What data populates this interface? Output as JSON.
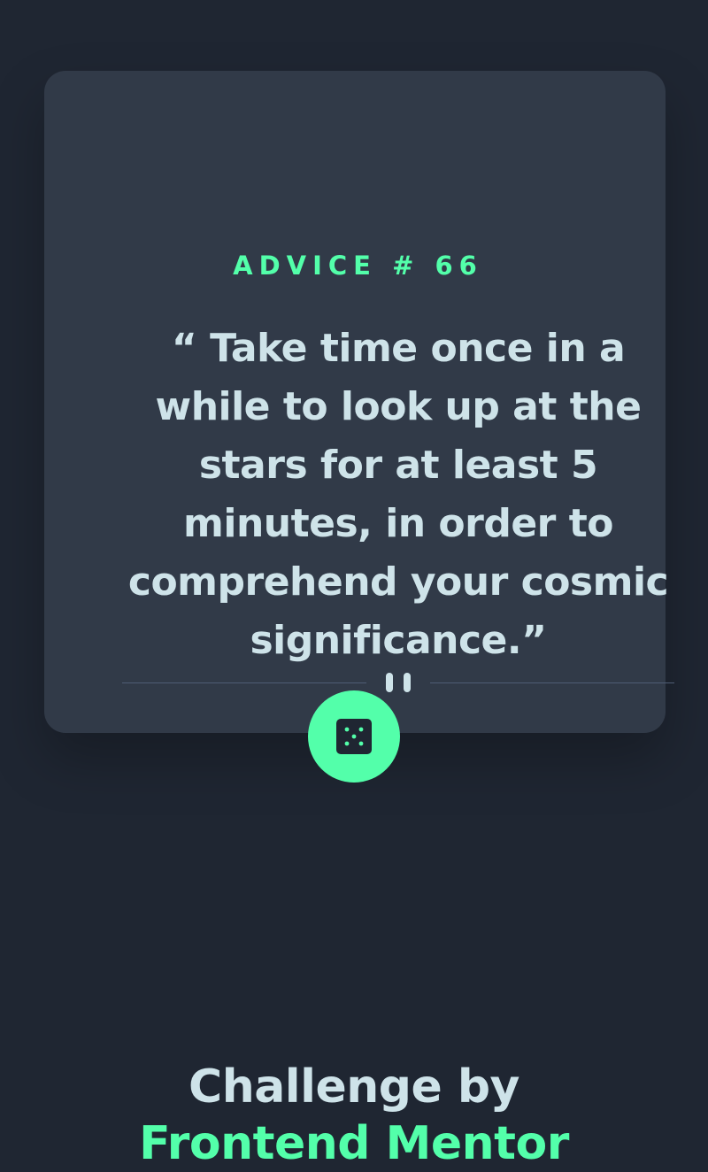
{
  "card": {
    "advice_label": "ADVICE # 66",
    "quote": "“ Take time once in a while to look up at the stars for at least 5 minutes, in order to comprehend your cosmic significance.”",
    "divider_icon": "pause-icon",
    "button_icon": "dice-icon"
  },
  "attribution": {
    "text": "Challenge by",
    "link_label": "Frontend Mentor"
  },
  "colors": {
    "background": "#1f2632",
    "card": "#313a48",
    "accent": "#53ffaa",
    "text": "#cee3e9",
    "divider": "#4f5d74"
  }
}
